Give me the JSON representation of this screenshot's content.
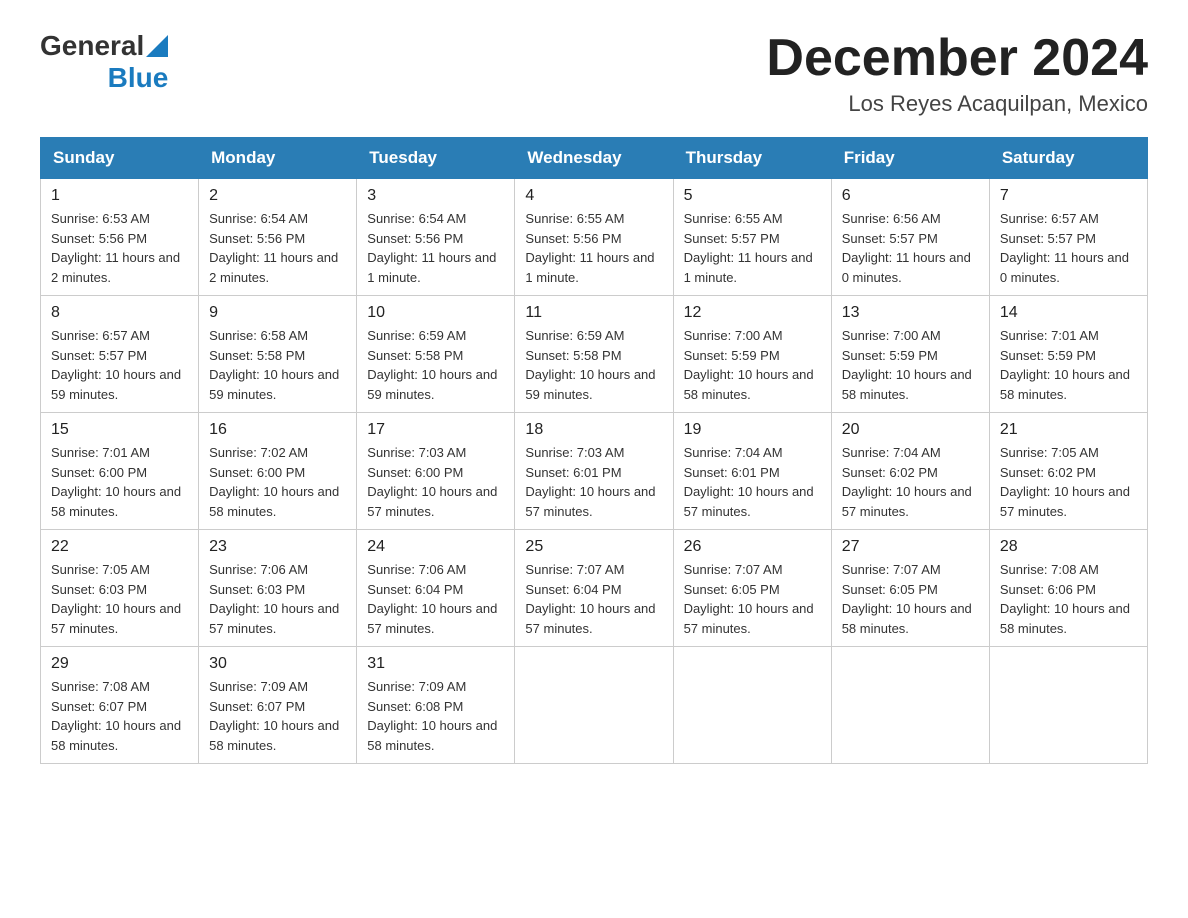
{
  "header": {
    "logo_general": "General",
    "logo_blue": "Blue",
    "month_title": "December 2024",
    "location": "Los Reyes Acaquilpan, Mexico"
  },
  "days_of_week": [
    "Sunday",
    "Monday",
    "Tuesday",
    "Wednesday",
    "Thursday",
    "Friday",
    "Saturday"
  ],
  "weeks": [
    [
      {
        "day": "1",
        "sunrise": "6:53 AM",
        "sunset": "5:56 PM",
        "daylight": "11 hours and 2 minutes."
      },
      {
        "day": "2",
        "sunrise": "6:54 AM",
        "sunset": "5:56 PM",
        "daylight": "11 hours and 2 minutes."
      },
      {
        "day": "3",
        "sunrise": "6:54 AM",
        "sunset": "5:56 PM",
        "daylight": "11 hours and 1 minute."
      },
      {
        "day": "4",
        "sunrise": "6:55 AM",
        "sunset": "5:56 PM",
        "daylight": "11 hours and 1 minute."
      },
      {
        "day": "5",
        "sunrise": "6:55 AM",
        "sunset": "5:57 PM",
        "daylight": "11 hours and 1 minute."
      },
      {
        "day": "6",
        "sunrise": "6:56 AM",
        "sunset": "5:57 PM",
        "daylight": "11 hours and 0 minutes."
      },
      {
        "day": "7",
        "sunrise": "6:57 AM",
        "sunset": "5:57 PM",
        "daylight": "11 hours and 0 minutes."
      }
    ],
    [
      {
        "day": "8",
        "sunrise": "6:57 AM",
        "sunset": "5:57 PM",
        "daylight": "10 hours and 59 minutes."
      },
      {
        "day": "9",
        "sunrise": "6:58 AM",
        "sunset": "5:58 PM",
        "daylight": "10 hours and 59 minutes."
      },
      {
        "day": "10",
        "sunrise": "6:59 AM",
        "sunset": "5:58 PM",
        "daylight": "10 hours and 59 minutes."
      },
      {
        "day": "11",
        "sunrise": "6:59 AM",
        "sunset": "5:58 PM",
        "daylight": "10 hours and 59 minutes."
      },
      {
        "day": "12",
        "sunrise": "7:00 AM",
        "sunset": "5:59 PM",
        "daylight": "10 hours and 58 minutes."
      },
      {
        "day": "13",
        "sunrise": "7:00 AM",
        "sunset": "5:59 PM",
        "daylight": "10 hours and 58 minutes."
      },
      {
        "day": "14",
        "sunrise": "7:01 AM",
        "sunset": "5:59 PM",
        "daylight": "10 hours and 58 minutes."
      }
    ],
    [
      {
        "day": "15",
        "sunrise": "7:01 AM",
        "sunset": "6:00 PM",
        "daylight": "10 hours and 58 minutes."
      },
      {
        "day": "16",
        "sunrise": "7:02 AM",
        "sunset": "6:00 PM",
        "daylight": "10 hours and 58 minutes."
      },
      {
        "day": "17",
        "sunrise": "7:03 AM",
        "sunset": "6:00 PM",
        "daylight": "10 hours and 57 minutes."
      },
      {
        "day": "18",
        "sunrise": "7:03 AM",
        "sunset": "6:01 PM",
        "daylight": "10 hours and 57 minutes."
      },
      {
        "day": "19",
        "sunrise": "7:04 AM",
        "sunset": "6:01 PM",
        "daylight": "10 hours and 57 minutes."
      },
      {
        "day": "20",
        "sunrise": "7:04 AM",
        "sunset": "6:02 PM",
        "daylight": "10 hours and 57 minutes."
      },
      {
        "day": "21",
        "sunrise": "7:05 AM",
        "sunset": "6:02 PM",
        "daylight": "10 hours and 57 minutes."
      }
    ],
    [
      {
        "day": "22",
        "sunrise": "7:05 AM",
        "sunset": "6:03 PM",
        "daylight": "10 hours and 57 minutes."
      },
      {
        "day": "23",
        "sunrise": "7:06 AM",
        "sunset": "6:03 PM",
        "daylight": "10 hours and 57 minutes."
      },
      {
        "day": "24",
        "sunrise": "7:06 AM",
        "sunset": "6:04 PM",
        "daylight": "10 hours and 57 minutes."
      },
      {
        "day": "25",
        "sunrise": "7:07 AM",
        "sunset": "6:04 PM",
        "daylight": "10 hours and 57 minutes."
      },
      {
        "day": "26",
        "sunrise": "7:07 AM",
        "sunset": "6:05 PM",
        "daylight": "10 hours and 57 minutes."
      },
      {
        "day": "27",
        "sunrise": "7:07 AM",
        "sunset": "6:05 PM",
        "daylight": "10 hours and 58 minutes."
      },
      {
        "day": "28",
        "sunrise": "7:08 AM",
        "sunset": "6:06 PM",
        "daylight": "10 hours and 58 minutes."
      }
    ],
    [
      {
        "day": "29",
        "sunrise": "7:08 AM",
        "sunset": "6:07 PM",
        "daylight": "10 hours and 58 minutes."
      },
      {
        "day": "30",
        "sunrise": "7:09 AM",
        "sunset": "6:07 PM",
        "daylight": "10 hours and 58 minutes."
      },
      {
        "day": "31",
        "sunrise": "7:09 AM",
        "sunset": "6:08 PM",
        "daylight": "10 hours and 58 minutes."
      },
      null,
      null,
      null,
      null
    ]
  ],
  "labels": {
    "sunrise": "Sunrise:",
    "sunset": "Sunset:",
    "daylight": "Daylight:"
  }
}
